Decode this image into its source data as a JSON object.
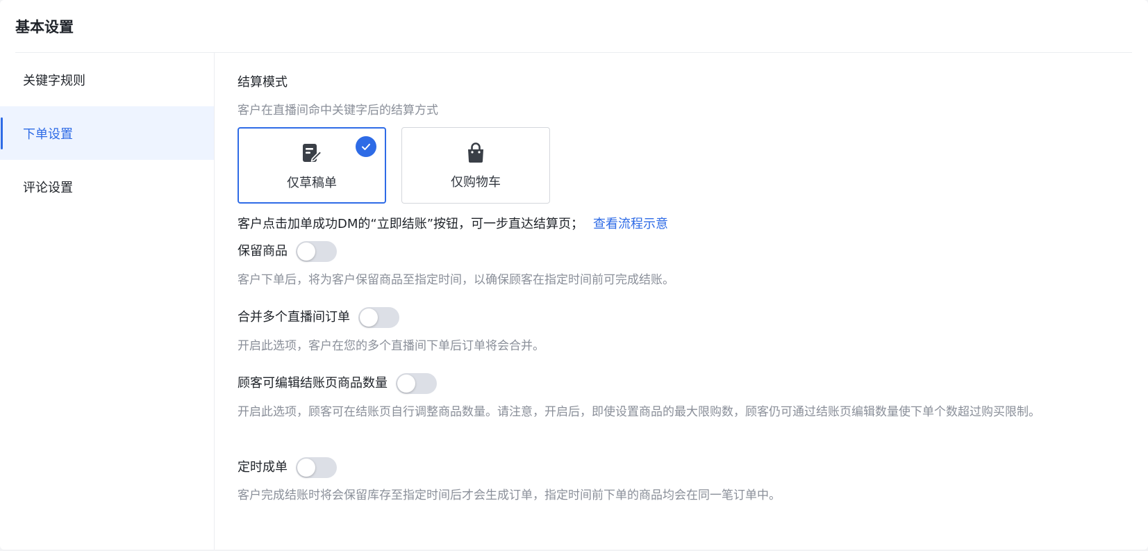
{
  "page": {
    "title": "基本设置"
  },
  "sidebar": {
    "items": [
      {
        "label": "关键字规则",
        "active": false
      },
      {
        "label": "下单设置",
        "active": true
      },
      {
        "label": "评论设置",
        "active": false
      }
    ]
  },
  "settlement": {
    "title": "结算模式",
    "description": "客户在直播间命中关键字后的结算方式",
    "options": [
      {
        "label": "仅草稿单",
        "icon": "draft-edit-icon",
        "selected": true
      },
      {
        "label": "仅购物车",
        "icon": "shopping-bag-icon",
        "selected": false
      }
    ],
    "checkout_text": "客户点击加单成功DM的“立即结账”按钮，可一步直达结算页；",
    "checkout_link": "查看流程示意"
  },
  "settings": [
    {
      "label": "保留商品",
      "enabled": false,
      "description": "客户下单后，将为客户保留商品至指定时间，以确保顾客在指定时间前可完成结账。"
    },
    {
      "label": "合并多个直播间订单",
      "enabled": false,
      "description": "开启此选项，客户在您的多个直播间下单后订单将会合并。"
    },
    {
      "label": "顾客可编辑结账页商品数量",
      "enabled": false,
      "description": "开启此选项，顾客可在结账页自行调整商品数量。请注意，开启后，即使设置商品的最大限购数，顾客仍可通过结账页编辑数量使下单个数超过购买限制。"
    },
    {
      "label": "定时成单",
      "enabled": false,
      "description": "客户完成结账时将会保留库存至指定时间后才会生成订单，指定时间前下单的商品均会在同一笔订单中。"
    }
  ],
  "colors": {
    "accent": "#2e6be6",
    "active_bg": "#eef4ff",
    "toggle_off": "#dcdfe6",
    "muted_text": "#8a8f99"
  }
}
